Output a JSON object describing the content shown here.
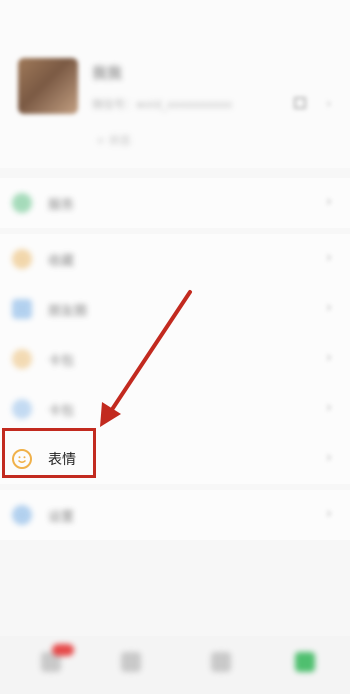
{
  "profile": {
    "name": "我我",
    "id": "微信号：wxid_xxxxxxxxxx",
    "status": "+ 状态"
  },
  "menu": {
    "service": {
      "label": "服务",
      "icon": "service-icon",
      "color": "#3db36b"
    },
    "favorites": {
      "label": "收藏",
      "icon": "favorites-icon",
      "color": "#e8a23c"
    },
    "moments": {
      "label": "朋友圈",
      "icon": "moments-icon",
      "color": "#4a8fd6"
    },
    "cards": {
      "label": "卡包",
      "icon": "card-icon",
      "color": "#e8a23c"
    },
    "stickers": {
      "label": "表情",
      "icon": "smiley-icon",
      "color": "#f0b14a"
    },
    "settings": {
      "label": "设置",
      "icon": "settings-icon",
      "color": "#4a8fd6"
    }
  },
  "highlight_color": "#c22a1f",
  "tabbar": {
    "tabs": [
      {
        "icon": "chats-tab-icon"
      },
      {
        "icon": "contacts-tab-icon"
      },
      {
        "icon": "discover-tab-icon"
      },
      {
        "icon": "me-tab-icon"
      }
    ]
  }
}
